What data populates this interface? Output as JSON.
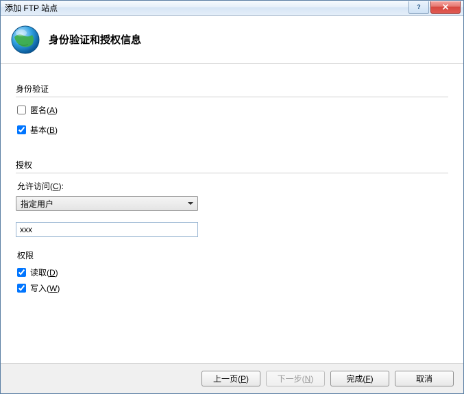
{
  "window": {
    "title": "添加 FTP 站点",
    "help_glyph": "?",
    "close_glyph": "x"
  },
  "header": {
    "title": "身份验证和授权信息"
  },
  "auth": {
    "group_title": "身份验证",
    "anonymous_label_pre": "匿名(",
    "anonymous_key": "A",
    "anonymous_label_post": ")",
    "anonymous_checked": false,
    "basic_label_pre": "基本(",
    "basic_key": "B",
    "basic_label_post": ")",
    "basic_checked": true
  },
  "authorization": {
    "group_title": "授权",
    "allow_label_pre": "允许访问(",
    "allow_key": "C",
    "allow_label_post": "):",
    "dropdown_value": "指定用户",
    "user_value": "xxx",
    "perm_title": "权限",
    "read_label_pre": "读取(",
    "read_key": "D",
    "read_label_post": ")",
    "read_checked": true,
    "write_label_pre": "写入(",
    "write_key": "W",
    "write_label_post": ")",
    "write_checked": true
  },
  "footer": {
    "prev_pre": "上一页(",
    "prev_key": "P",
    "prev_post": ")",
    "next_pre": "下一步(",
    "next_key": "N",
    "next_post": ")",
    "finish_pre": "完成(",
    "finish_key": "F",
    "finish_post": ")",
    "cancel": "取消"
  }
}
